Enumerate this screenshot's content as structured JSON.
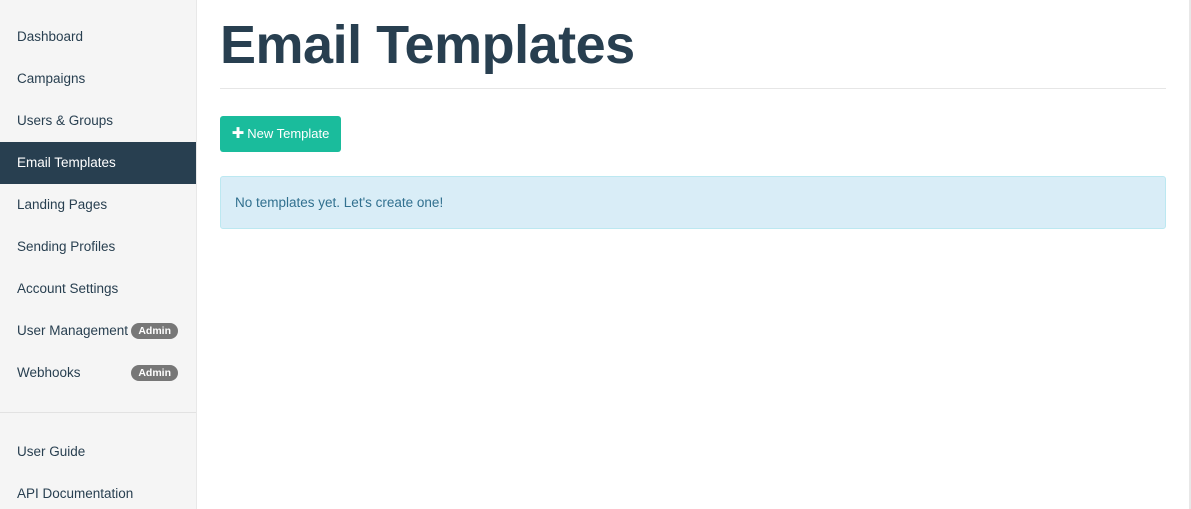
{
  "sidebar": {
    "items": [
      {
        "label": "Dashboard"
      },
      {
        "label": "Campaigns"
      },
      {
        "label": "Users & Groups"
      },
      {
        "label": "Email Templates",
        "active": true
      },
      {
        "label": "Landing Pages"
      },
      {
        "label": "Sending Profiles"
      },
      {
        "label": "Account Settings"
      },
      {
        "label": "User Management",
        "badge": "Admin"
      },
      {
        "label": "Webhooks",
        "badge": "Admin"
      }
    ],
    "bottom_items": [
      {
        "label": "User Guide"
      },
      {
        "label": "API Documentation"
      }
    ]
  },
  "main": {
    "title": "Email Templates",
    "new_button_label": "New Template",
    "empty_message": "No templates yet. Let's create one!"
  },
  "colors": {
    "brand_dark": "#283f50",
    "accent": "#1abc9c",
    "info_bg": "#d9edf7",
    "info_text": "#31708f",
    "badge": "#777777"
  },
  "icons": {
    "new_button_icon": "plus-icon"
  }
}
